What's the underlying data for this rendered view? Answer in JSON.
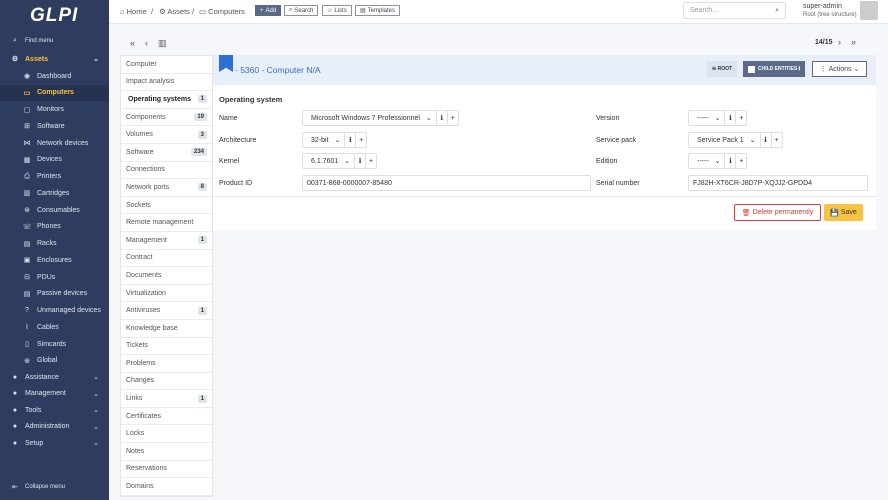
{
  "logo": "GLPI",
  "sidebar": {
    "find_menu": "Find menu",
    "collapse": "Collapse menu",
    "sections": [
      "Assets",
      "Assistance",
      "Management",
      "Tools",
      "Administration",
      "Setup"
    ],
    "assets": [
      "Dashboard",
      "Computers",
      "Monitors",
      "Software",
      "Network devices",
      "Devices",
      "Printers",
      "Cartridges",
      "Consumables",
      "Phones",
      "Racks",
      "Enclosures",
      "PDUs",
      "Passive devices",
      "Unmanaged devices",
      "Cables",
      "Simcards",
      "Global"
    ]
  },
  "header": {
    "breadcrumb": [
      "Home",
      "Assets",
      "Computers"
    ],
    "buttons": [
      "Add",
      "Search",
      "Lists",
      "Templates"
    ],
    "search_placeholder": "Search...",
    "user": "super-admin",
    "entity": "Root (tree structure)"
  },
  "nav": {
    "position": "14/15"
  },
  "tabs": [
    {
      "label": "Computer"
    },
    {
      "label": "Impact analysis"
    },
    {
      "label": "Operating systems",
      "count": "1"
    },
    {
      "label": "Components",
      "count": "19"
    },
    {
      "label": "Volumes",
      "count": "3"
    },
    {
      "label": "Software",
      "count": "234"
    },
    {
      "label": "Connections"
    },
    {
      "label": "Network ports",
      "count": "8"
    },
    {
      "label": "Sockets"
    },
    {
      "label": "Remote management"
    },
    {
      "label": "Management",
      "count": "1"
    },
    {
      "label": "Contract"
    },
    {
      "label": "Documents"
    },
    {
      "label": "Virtualization"
    },
    {
      "label": "Antiviruses",
      "count": "1"
    },
    {
      "label": "Knowledge base"
    },
    {
      "label": "Tickets"
    },
    {
      "label": "Problems"
    },
    {
      "label": "Changes"
    },
    {
      "label": "Links",
      "count": "1"
    },
    {
      "label": "Certificates"
    },
    {
      "label": "Locks"
    },
    {
      "label": "Notes"
    },
    {
      "label": "Reservations"
    },
    {
      "label": "Domains"
    }
  ],
  "main": {
    "title": "- 5360 - Computer N/A",
    "root": "ROOT",
    "child_entities": "CHILD ENTITIES",
    "actions": "Actions",
    "section": "Operating system",
    "fields": {
      "name_label": "Name",
      "name": "Microsoft Windows 7 Professionnel",
      "arch_label": "Architecture",
      "arch": "32-bit",
      "kernel_label": "Kernel",
      "kernel": "6.1.7601",
      "product_label": "Product ID",
      "product": "00371-868-0000007-85480",
      "version_label": "Version",
      "version": "-----",
      "sp_label": "Service pack",
      "sp": "Service Pack 1",
      "edition_label": "Edition",
      "edition": "-----",
      "serial_label": "Serial number",
      "serial": "FJ82H-XT6CR-J8D7P-XQJJ2-GPDD4"
    },
    "delete": "Delete permanently",
    "save": "Save"
  },
  "colors": {
    "sidebar": "#2e3d5f",
    "active": "#f6c343",
    "accent": "#2f6fd6",
    "delete": "#d63939",
    "save": "#f6c343"
  }
}
